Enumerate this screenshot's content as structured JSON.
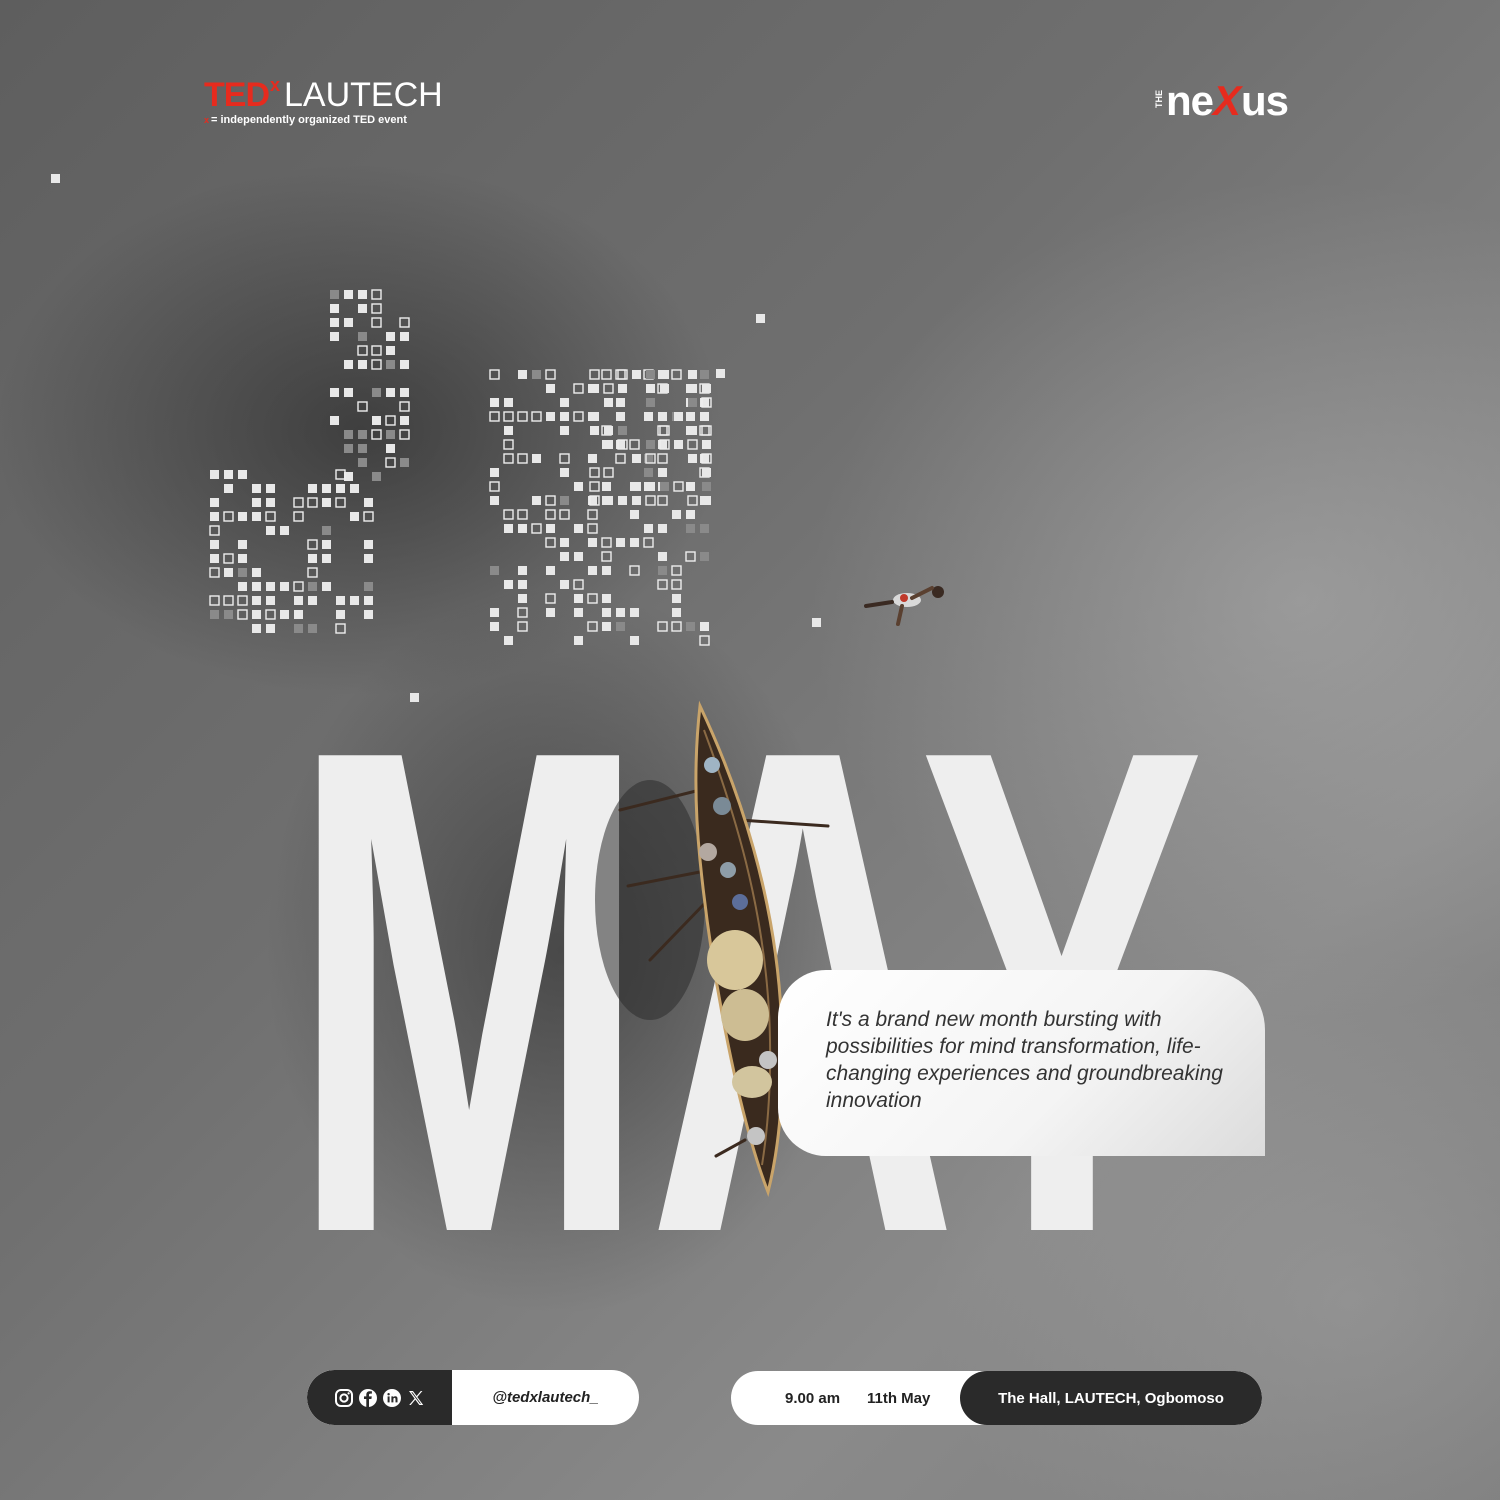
{
  "header": {
    "ted_logo": {
      "brand": "TED",
      "superscript": "x",
      "name": "LAUTECH",
      "tagline_mark": "x",
      "tagline": "= independently organized TED event"
    },
    "partner_logo": {
      "prefix": "THE",
      "text_before": "ne",
      "text_x": "X",
      "text_after": "us"
    }
  },
  "headline": "MAY",
  "quote": "It's a brand new month bursting with possibilities for mind transformation, life-changing experiences and groundbreaking innovation",
  "social": {
    "icons": [
      "instagram-icon",
      "facebook-icon",
      "linkedin-icon",
      "x-icon"
    ],
    "handle": "@tedxlautech_"
  },
  "event": {
    "time": "9.00 am",
    "date": "11th May",
    "venue": "The Hall, LAUTECH, Ogbomoso"
  },
  "colors": {
    "ted_red": "#e62b1e",
    "dark_pill": "#2a2a2a",
    "light": "#ffffff"
  }
}
